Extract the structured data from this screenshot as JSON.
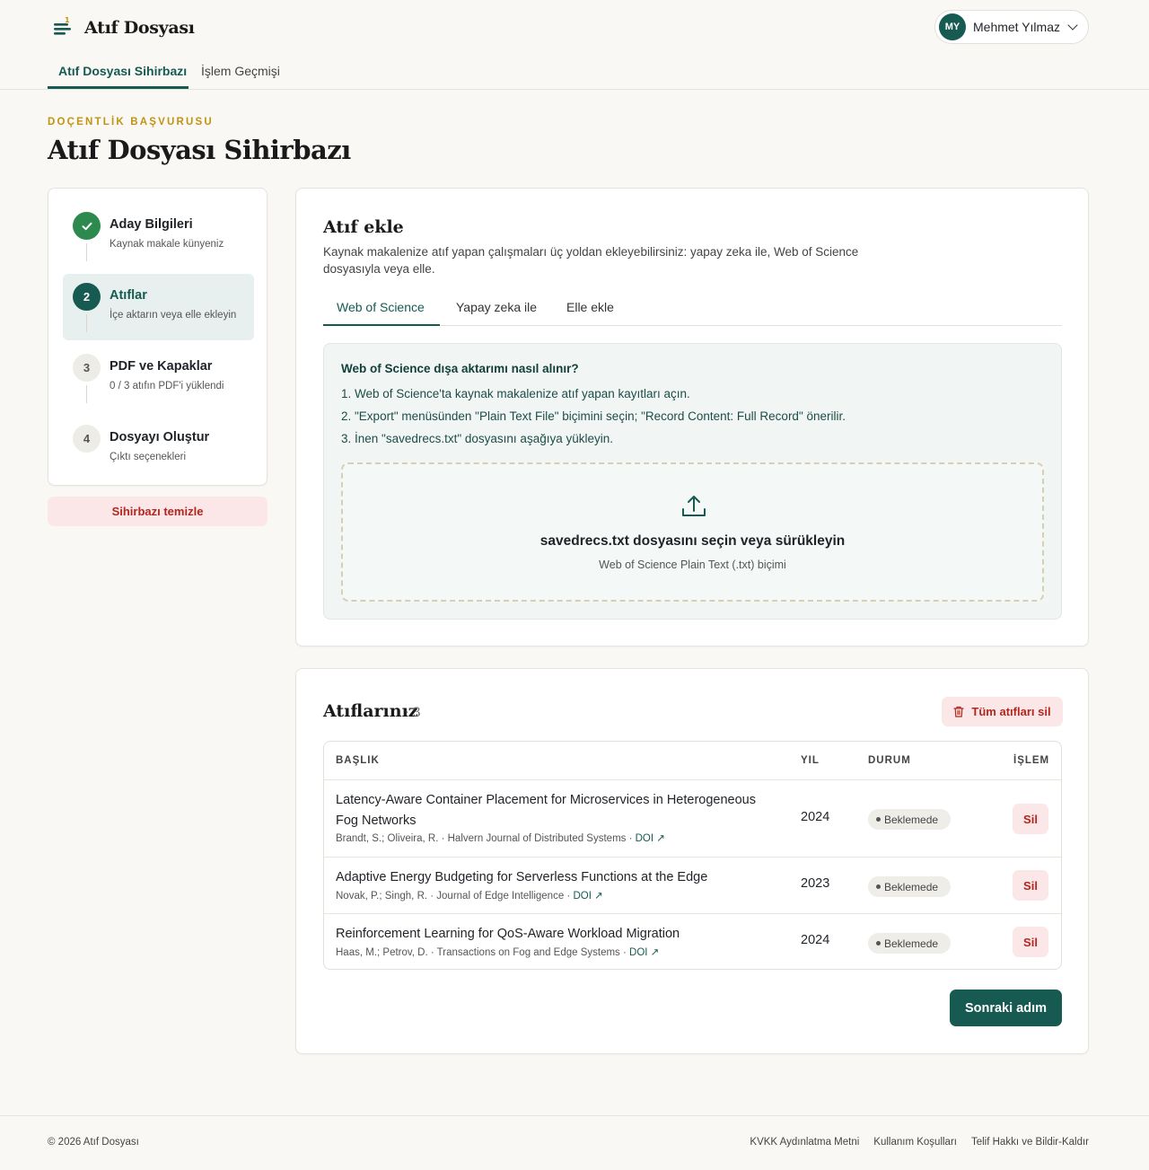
{
  "app": {
    "title": "Atıf Dosyası"
  },
  "user": {
    "initials": "MY",
    "name": "Mehmet Yılmaz"
  },
  "nav": {
    "tabs": [
      {
        "label": "Atıf Dosyası Sihirbazı"
      },
      {
        "label": "İşlem Geçmişi"
      }
    ]
  },
  "page": {
    "eyebrow": "DOÇENTLİK BAŞVURUSU",
    "title": "Atıf Dosyası Sihirbazı"
  },
  "stepper": {
    "steps": [
      {
        "num": "",
        "title": "Aday Bilgileri",
        "sub": "Kaynak makale künyeniz",
        "state": "done"
      },
      {
        "num": "2",
        "title": "Atıflar",
        "sub": "İçe aktarın veya elle ekleyin",
        "state": "current"
      },
      {
        "num": "3",
        "title": "PDF ve Kapaklar",
        "sub": "0 / 3 atıfın PDF'i yüklendi",
        "state": "todo"
      },
      {
        "num": "4",
        "title": "Dosyayı Oluştur",
        "sub": "Çıktı seçenekleri",
        "state": "todo"
      }
    ],
    "clear_label": "Sihirbazı temizle"
  },
  "add": {
    "title": "Atıf ekle",
    "desc": "Kaynak makalenize atıf yapan çalışmaları üç yoldan ekleyebilirsiniz: yapay zeka ile, Web of Science dosyasıyla veya elle.",
    "tabs": [
      {
        "label": "Web of Science"
      },
      {
        "label": "Yapay zeka ile"
      },
      {
        "label": "Elle ekle"
      }
    ],
    "howto": {
      "title": "Web of Science dışa aktarımı nasıl alınır?",
      "steps": [
        "1. Web of Science'ta kaynak makalenize atıf yapan kayıtları açın.",
        "2. \"Export\" menüsünden \"Plain Text File\" biçimini seçin; \"Record Content: Full Record\" önerilir.",
        "3. İnen \"savedrecs.txt\" dosyasını aşağıya yükleyin."
      ]
    },
    "drop": {
      "title": "savedrecs.txt dosyasını seçin veya sürükleyin",
      "sub": "Web of Science Plain Text (.txt) biçimi"
    }
  },
  "list": {
    "title": "Atıflarınız",
    "count": "· 3",
    "delete_all_label": "Tüm atıfları sil",
    "headers": {
      "title": "BAŞLIK",
      "year": "YIL",
      "status": "DURUM",
      "action": "İŞLEM"
    },
    "rows": [
      {
        "title": "Latency-Aware Container Placement for Microservices in Heterogeneous Fog Networks",
        "meta": "Brandt, S.; Oliveira, R. · Halvern Journal of Distributed Systems · ",
        "doi": "DOI ↗",
        "year": "2024",
        "status": "Beklemede",
        "action": "Sil"
      },
      {
        "title": "Adaptive Energy Budgeting for Serverless Functions at the Edge",
        "meta": "Novak, P.; Singh, R. · Journal of Edge Intelligence · ",
        "doi": "DOI ↗",
        "year": "2023",
        "status": "Beklemede",
        "action": "Sil"
      },
      {
        "title": "Reinforcement Learning for QoS-Aware Workload Migration",
        "meta": "Haas, M.; Petrov, D. · Transactions on Fog and Edge Systems · ",
        "doi": "DOI ↗",
        "year": "2024",
        "status": "Beklemede",
        "action": "Sil"
      }
    ],
    "next_label": "Sonraki adım"
  },
  "footer": {
    "copyright": "© 2026 Atıf Dosyası",
    "links": [
      "KVKK Aydınlatma Metni",
      "Kullanım Koşulları",
      "Telif Hakkı ve Bildir-Kaldır"
    ]
  },
  "colors": {
    "brand": "#165a52",
    "accent": "#c2930f",
    "danger": "#b3261e",
    "done": "#2d8a4e"
  }
}
